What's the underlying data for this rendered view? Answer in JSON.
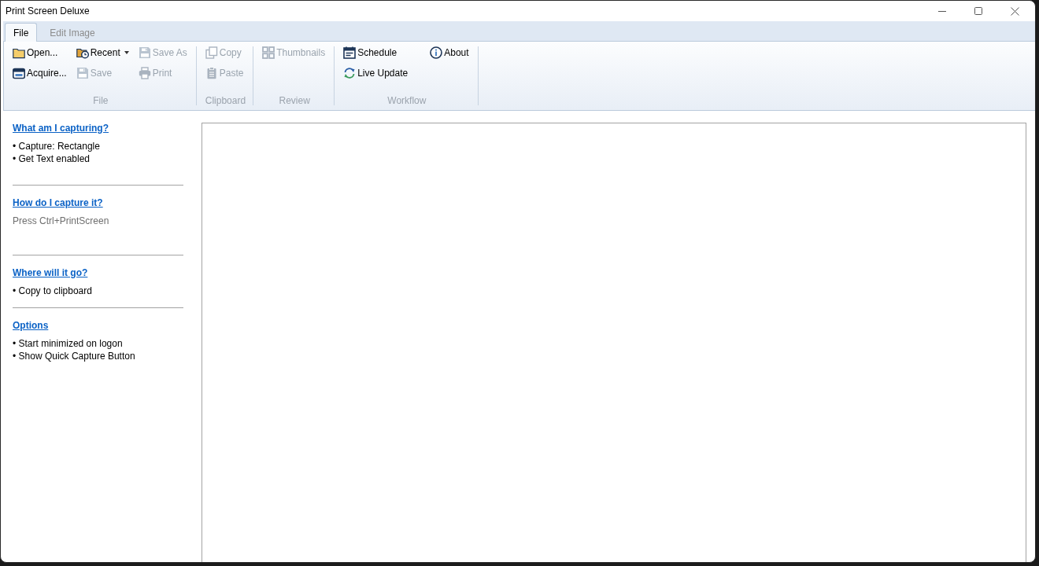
{
  "window": {
    "title": "Print Screen Deluxe"
  },
  "tabs": [
    {
      "label": "File",
      "selected": true
    },
    {
      "label": "Edit Image",
      "selected": false
    }
  ],
  "ribbon": {
    "groups": [
      {
        "label": "File",
        "columns": [
          [
            {
              "label": "Open...",
              "disabled": false,
              "dropdown": false
            },
            {
              "label": "Acquire...",
              "disabled": false,
              "dropdown": false
            }
          ],
          [
            {
              "label": "Recent",
              "disabled": false,
              "dropdown": true
            },
            {
              "label": "Save",
              "disabled": true,
              "dropdown": false
            }
          ],
          [
            {
              "label": "Save As",
              "disabled": true,
              "dropdown": false
            },
            {
              "label": "Print",
              "disabled": true,
              "dropdown": false
            }
          ]
        ]
      },
      {
        "label": "Clipboard",
        "columns": [
          [
            {
              "label": "Copy",
              "disabled": true,
              "dropdown": false
            },
            {
              "label": "Paste",
              "disabled": true,
              "dropdown": false
            }
          ]
        ]
      },
      {
        "label": "Review",
        "columns": [
          [
            {
              "label": "Thumbnails",
              "disabled": true,
              "dropdown": false
            }
          ]
        ]
      },
      {
        "label": "Workflow",
        "columns": [
          [
            {
              "label": "Schedule",
              "disabled": false,
              "dropdown": false
            },
            {
              "label": "Live Update",
              "disabled": false,
              "dropdown": false
            }
          ],
          [
            {
              "label": "About",
              "disabled": false,
              "dropdown": false
            }
          ]
        ]
      }
    ]
  },
  "sidebar": {
    "sections": [
      {
        "heading": "What am I capturing?",
        "lines": [
          {
            "text": "• Capture: Rectangle",
            "greyed": false
          },
          {
            "text": "• Get Text enabled",
            "greyed": false
          }
        ]
      },
      {
        "heading": "How do I capture it?",
        "lines": [
          {
            "text": "Press Ctrl+PrintScreen",
            "greyed": true
          }
        ]
      },
      {
        "heading": "Where will it go?",
        "lines": [
          {
            "text": "• Copy to clipboard",
            "greyed": false
          }
        ]
      },
      {
        "heading": "Options",
        "lines": [
          {
            "text": "• Start minimized on logon",
            "greyed": false
          },
          {
            "text": "• Show Quick Capture Button",
            "greyed": false
          }
        ]
      }
    ]
  }
}
